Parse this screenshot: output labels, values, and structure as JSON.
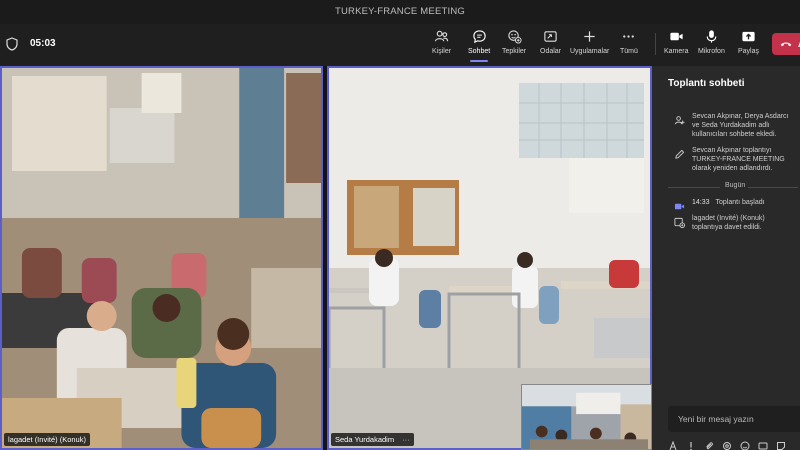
{
  "window": {
    "title": "TURKEY-FRANCE MEETING"
  },
  "toolbar": {
    "timer": "05:03",
    "buttons": [
      {
        "label": "Kişiler",
        "icon": "people-icon"
      },
      {
        "label": "Sohbet",
        "icon": "chat-icon",
        "active": true
      },
      {
        "label": "Tepkiler",
        "icon": "reactions-icon"
      },
      {
        "label": "Odalar",
        "icon": "rooms-icon"
      },
      {
        "label": "Uygulamalar",
        "icon": "apps-icon"
      },
      {
        "label": "Tümü",
        "icon": "more-icon"
      },
      {
        "label": "Kamera",
        "icon": "camera-icon"
      },
      {
        "label": "Mikrofon",
        "icon": "microphone-icon"
      },
      {
        "label": "Paylaş",
        "icon": "share-icon"
      }
    ],
    "leave_label": "A",
    "leave_color": "#c4314b"
  },
  "videos": [
    {
      "name": "lagadet (Invité) (Konuk)"
    },
    {
      "name": "Seda Yurdakadim",
      "more": "···"
    }
  ],
  "chat": {
    "title": "Toplantı sohbeti",
    "events": [
      {
        "icon": "people-added-icon",
        "text": "Sevcan Akpınar, Derya Asdarcı ve Seda Yurdakadim adlı kullanıcıları sohbete ekledi."
      },
      {
        "icon": "pencil-icon",
        "text": "Sevcan Akpınar toplantıyı TURKEY-FRANCE MEETING olarak yeniden adlandırdı."
      }
    ],
    "day_separator": "Bugün",
    "today_events": [
      {
        "icon": "video-icon",
        "time": "14:33",
        "text": "Toplantı başladı"
      },
      {
        "icon": "invite-icon",
        "text": "lagadet (Invité) (Konuk) toplantıya davet edildi."
      }
    ],
    "composer_placeholder": "Yeni bir mesaj yazın"
  },
  "accent": "#5b5fc7"
}
